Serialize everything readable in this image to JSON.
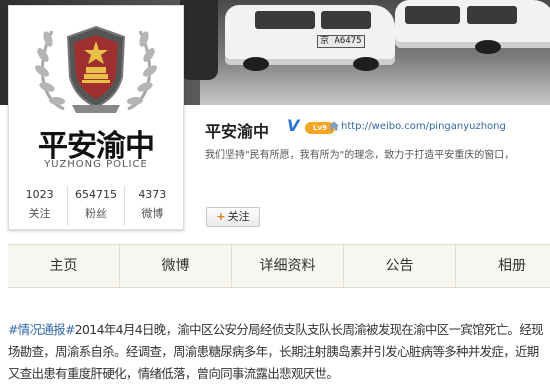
{
  "cover": {
    "plate": "京 A6475"
  },
  "profile": {
    "avatar_title": "平安渝中",
    "avatar_subtitle": "YUZHONG POLICE",
    "name": "平安渝中",
    "verified_mark": "V",
    "level_badge": "Lv9",
    "url": "http://weibo.com/pinganyuzhong",
    "motto": "我们坚持\"民有所愿，我有所为\"的理念，致力于打造平安重庆的窗口，",
    "follow_label": "关注",
    "stats": [
      {
        "num": "1023",
        "label": "关注"
      },
      {
        "num": "654715",
        "label": "粉丝"
      },
      {
        "num": "4373",
        "label": "微博"
      }
    ]
  },
  "tabs": [
    "主页",
    "微博",
    "详细资料",
    "公告",
    "相册"
  ],
  "post": {
    "tag": "#情况通报#",
    "text": "2014年4月4日晚，渝中区公安分局经侦支队支队长周渝被发现在渝中区一宾馆死亡。经现场勘查，周渝系自杀。经调查，周渝患糖尿病多年，长期注射胰岛素并引发心脏病等多种并发症，近期又查出患有重度肝硬化，情绪低落，曾向同事流露出悲观厌世。"
  },
  "colors": {
    "link": "#3468a8",
    "verified": "#2a73d6",
    "badge": "#f5a623"
  }
}
